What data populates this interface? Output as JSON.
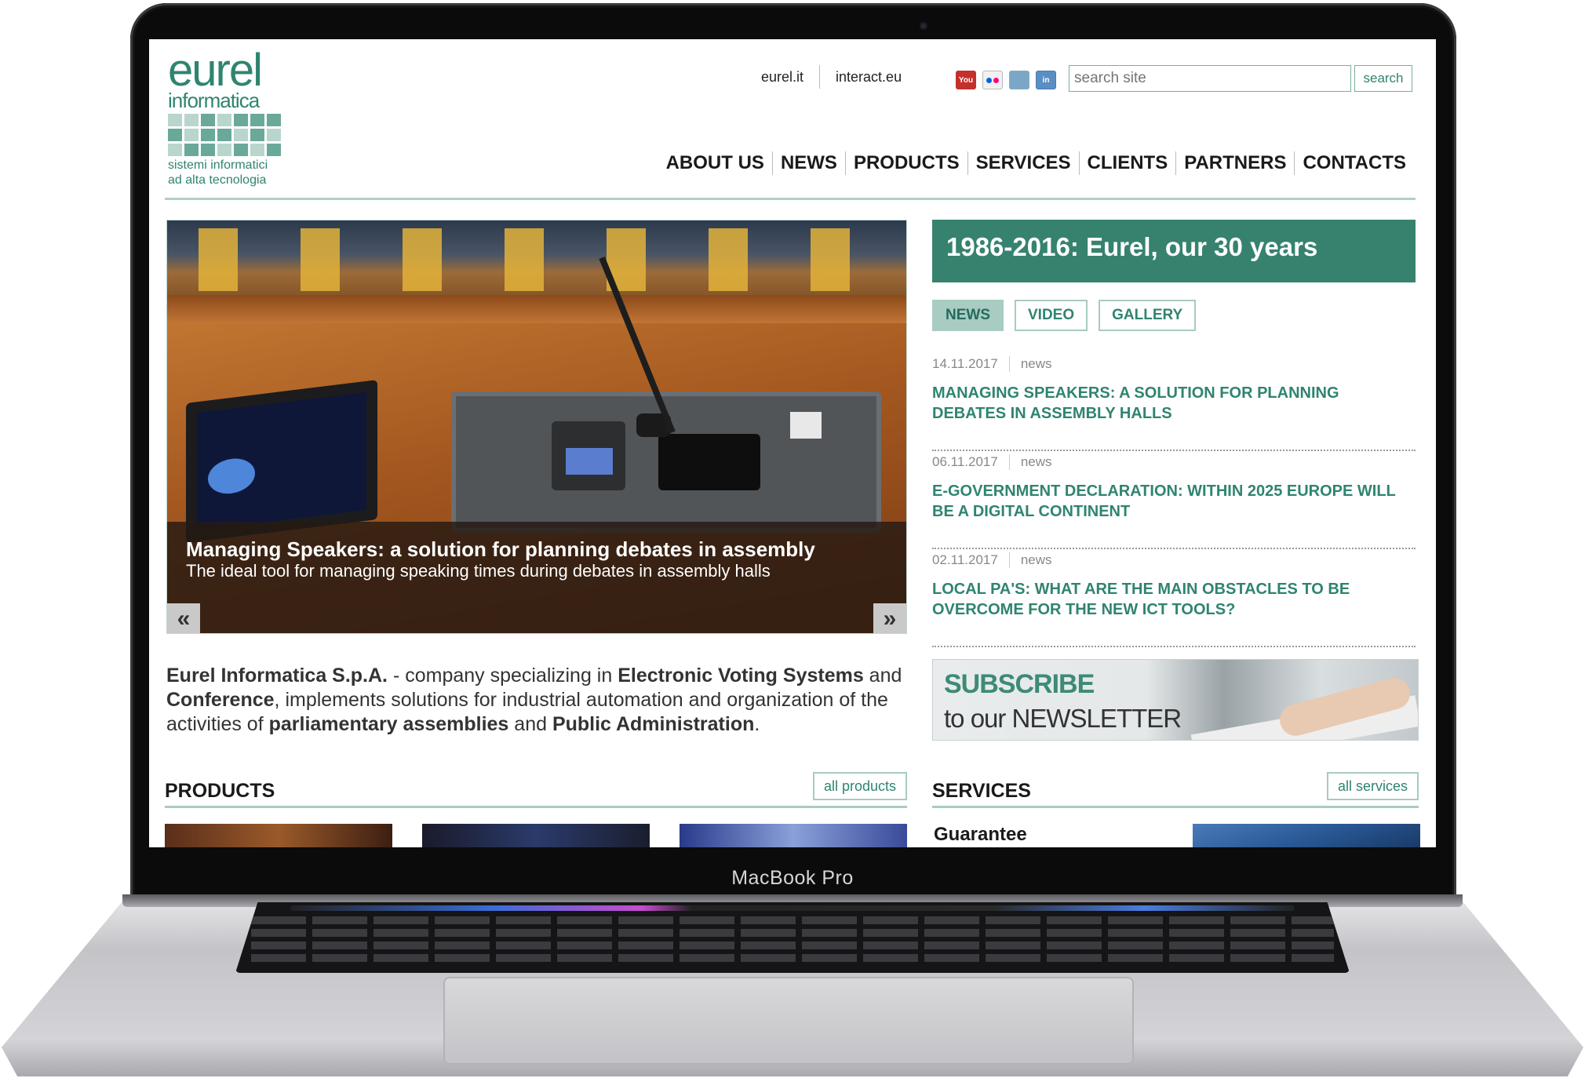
{
  "device": {
    "model_label": "MacBook Pro"
  },
  "logo": {
    "word": "eurel",
    "sub": "informatica",
    "tagline_1": "sistemi informatici",
    "tagline_2": "ad alta tecnologia",
    "color": "#2f8470"
  },
  "header": {
    "links": [
      "eurel.it",
      "interact.eu"
    ],
    "social": [
      {
        "icon": "youtube-icon",
        "label": "You\nTube"
      },
      {
        "icon": "flickr-icon"
      },
      {
        "icon": "photo-gallery-icon"
      },
      {
        "icon": "linkedin-icon",
        "label": "in"
      }
    ],
    "search": {
      "placeholder": "search site",
      "button": "search"
    }
  },
  "nav": [
    "ABOUT US",
    "NEWS",
    "PRODUCTS",
    "SERVICES",
    "CLIENTS",
    "PARTNERS",
    "CONTACTS"
  ],
  "hero": {
    "title": "Managing Speakers: a solution for planning debates in assembly",
    "subtitle": "The ideal tool for managing speaking times during debates in assembly halls",
    "prev": "«",
    "next": "»"
  },
  "anniversary": {
    "title": "1986-2016: Eurel, our 30 years"
  },
  "tabs": [
    {
      "label": "NEWS",
      "active": true
    },
    {
      "label": "VIDEO",
      "active": false
    },
    {
      "label": "GALLERY",
      "active": false
    }
  ],
  "news": [
    {
      "date": "14.11.2017",
      "category": "news",
      "title": "MANAGING SPEAKERS: A SOLUTION FOR PLANNING DEBATES IN ASSEMBLY HALLS"
    },
    {
      "date": "06.11.2017",
      "category": "news",
      "title": "E-GOVERNMENT DECLARATION: WITHIN 2025 EUROPE WILL BE A DIGITAL CONTINENT"
    },
    {
      "date": "02.11.2017",
      "category": "news",
      "title": "LOCAL PA'S: WHAT ARE THE MAIN OBSTACLES TO BE OVERCOME FOR THE NEW ICT TOOLS?"
    }
  ],
  "newsletter": {
    "line1": "SUBSCRIBE",
    "line2": "to our NEWSLETTER"
  },
  "intro": {
    "company": "Eurel Informatica S.p.A.",
    "t1": " - company specializing in ",
    "b1": "Electronic Voting Systems",
    "t2": " and ",
    "b2": "Conference",
    "t3": ", implements solutions for industrial automation and organization of the activities of ",
    "b3": "parliamentary assemblies",
    "t4": " and ",
    "b4": "Public Administration",
    "t5": "."
  },
  "products": {
    "title": "PRODUCTS",
    "more": "all products"
  },
  "services": {
    "title": "SERVICES",
    "more": "all services",
    "first_item": "Guarantee"
  },
  "colors": {
    "accent": "#36826f",
    "accent_light": "#a8cbc2",
    "link": "#2f8470"
  }
}
